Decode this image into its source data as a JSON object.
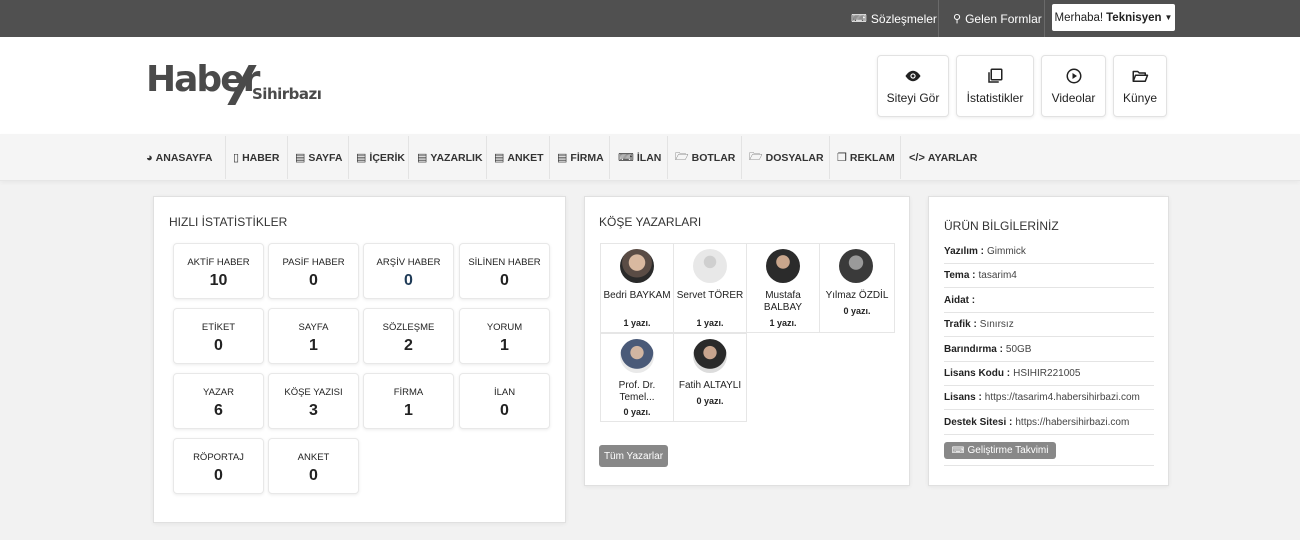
{
  "topbar": {
    "contracts": {
      "icon": "keyboard-icon",
      "label": "Sözleşmeler"
    },
    "forms": {
      "icon": "lightbulb-icon",
      "label": "Gelen Formlar"
    },
    "user": {
      "greeting": "Merhaba!",
      "name": "Teknisyen"
    }
  },
  "logo": {
    "main": "Haber",
    "sub": "Sihirbazı"
  },
  "quick_buttons": [
    {
      "label": "Siteyi Gör",
      "icon": "eye-icon"
    },
    {
      "label": "İstatistikler",
      "icon": "copy-icon"
    },
    {
      "label": "Videolar",
      "icon": "play-circle-icon"
    },
    {
      "label": "Künye",
      "icon": "folder-open-icon"
    }
  ],
  "nav": [
    {
      "label": "ANASAYFA",
      "icon": "dashboard-icon"
    },
    {
      "label": "HABER",
      "icon": "file-icon"
    },
    {
      "label": "SAYFA",
      "icon": "file-text-icon"
    },
    {
      "label": "İÇERİK",
      "icon": "file-text-icon"
    },
    {
      "label": "YAZARLIK",
      "icon": "file-text-icon"
    },
    {
      "label": "ANKET",
      "icon": "file-text-icon"
    },
    {
      "label": "FİRMA",
      "icon": "file-text-icon"
    },
    {
      "label": "İLAN",
      "icon": "keyboard-icon"
    },
    {
      "label": "BOTLAR",
      "icon": "folder-open-icon"
    },
    {
      "label": "DOSYALAR",
      "icon": "folder-open-icon"
    },
    {
      "label": "REKLAM",
      "icon": "copy-icon"
    },
    {
      "label": "AYARLAR",
      "icon": "code-icon"
    }
  ],
  "stats_panel": {
    "title": "HIZLI İSTATİSTİKLER",
    "items": [
      {
        "label": "AKTİF HABER",
        "value": "10"
      },
      {
        "label": "PASİF HABER",
        "value": "0"
      },
      {
        "label": "ARŞİV HABER",
        "value": "0"
      },
      {
        "label": "SİLİNEN HABER",
        "value": "0"
      },
      {
        "label": "ETİKET",
        "value": "0"
      },
      {
        "label": "SAYFA",
        "value": "1"
      },
      {
        "label": "SÖZLEŞME",
        "value": "2"
      },
      {
        "label": "YORUM",
        "value": "1"
      },
      {
        "label": "YAZAR",
        "value": "6"
      },
      {
        "label": "KÖŞE YAZISI",
        "value": "3"
      },
      {
        "label": "FİRMA",
        "value": "1"
      },
      {
        "label": "İLAN",
        "value": "0"
      },
      {
        "label": "RÖPORTAJ",
        "value": "0"
      },
      {
        "label": "ANKET",
        "value": "0"
      }
    ]
  },
  "authors_panel": {
    "title": "KÖŞE YAZARLARI",
    "authors": [
      {
        "name": "Bedri BAYKAM",
        "count": "1 yazı."
      },
      {
        "name": "Servet TÖRER",
        "count": "1 yazı."
      },
      {
        "name": "Mustafa BALBAY",
        "count": "1 yazı."
      },
      {
        "name": "Yılmaz ÖZDİL",
        "count": "0 yazı."
      },
      {
        "name": "Prof. Dr. Temel...",
        "count": "0 yazı."
      },
      {
        "name": "Fatih ALTAYLI",
        "count": "0 yazı."
      }
    ],
    "all_button": "Tüm Yazarlar"
  },
  "product_panel": {
    "title": "ÜRÜN BİLGİLERİNİZ",
    "rows": [
      {
        "key": "Yazılım :",
        "value": "Gimmick"
      },
      {
        "key": "Tema :",
        "value": "tasarim4"
      },
      {
        "key": "Aidat :",
        "value": ""
      },
      {
        "key": "Trafik :",
        "value": "Sınırsız"
      },
      {
        "key": "Barındırma :",
        "value": "50GB"
      },
      {
        "key": "Lisans Kodu :",
        "value": "HSIHIR221005"
      },
      {
        "key": "Lisans :",
        "value": "https://tasarim4.habersihirbazi.com"
      },
      {
        "key": "Destek Sitesi :",
        "value": "https://habersihirbazi.com"
      }
    ],
    "dev_button": {
      "icon": "keyboard-icon",
      "label": "Geliştirme Takvimi"
    }
  }
}
